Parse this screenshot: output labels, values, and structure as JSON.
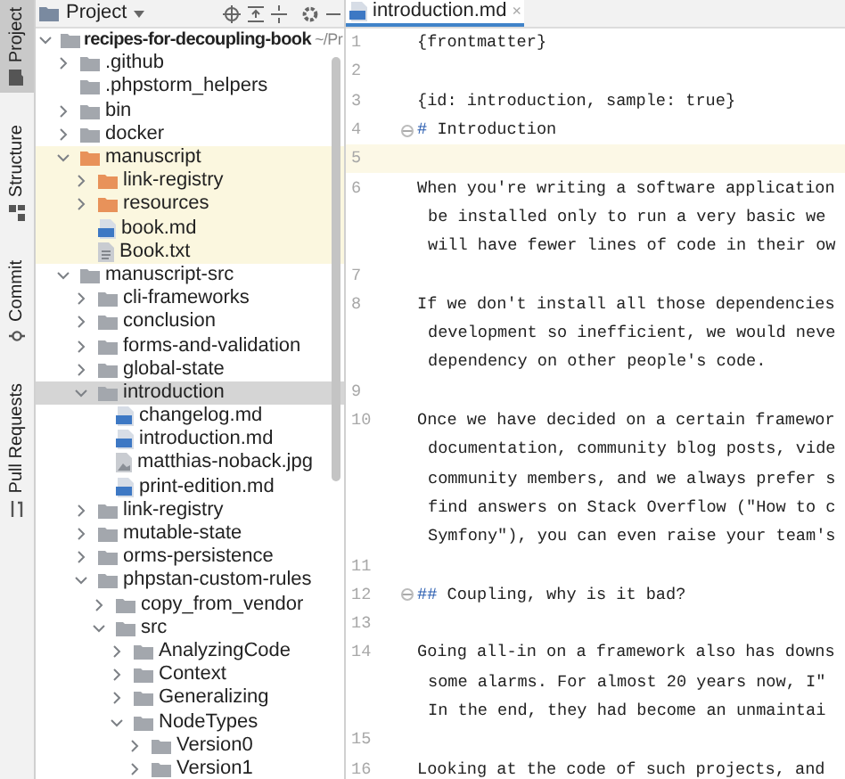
{
  "tool_strip": [
    {
      "label": "Project",
      "selected": true
    },
    {
      "label": "Structure",
      "selected": false
    },
    {
      "label": "Commit",
      "selected": false
    },
    {
      "label": "Pull Requests",
      "selected": false
    }
  ],
  "project_panel": {
    "title": "Project",
    "tree": {
      "name": "recipes-for-decoupling-book",
      "path": "~/Pr",
      "expanded": true,
      "children": [
        {
          "name": ".github",
          "kind": "folder",
          "expanded": false,
          "highlighted": false,
          "selected": false
        },
        {
          "name": ".phpstorm_helpers",
          "kind": "folder",
          "highlighted": false,
          "selected": false
        },
        {
          "name": "bin",
          "kind": "folder",
          "expanded": false,
          "highlighted": false,
          "selected": false
        },
        {
          "name": "docker",
          "kind": "folder",
          "expanded": false,
          "highlighted": false,
          "selected": false
        },
        {
          "name": "manuscript",
          "kind": "resource",
          "expanded": true,
          "highlighted": true,
          "selected": false,
          "children": [
            {
              "name": "link-registry",
              "kind": "resource",
              "expanded": false,
              "selected": false
            },
            {
              "name": "resources",
              "kind": "resource",
              "expanded": false,
              "selected": false
            },
            {
              "name": "book.md",
              "kind": "markdown",
              "selected": false
            },
            {
              "name": "Book.txt",
              "kind": "text",
              "selected": false
            }
          ]
        },
        {
          "name": "manuscript-src",
          "kind": "folder",
          "expanded": true,
          "highlighted": false,
          "selected": false,
          "children": [
            {
              "name": "cli-frameworks",
              "kind": "folder",
              "expanded": false,
              "selected": false
            },
            {
              "name": "conclusion",
              "kind": "folder",
              "expanded": false,
              "selected": false
            },
            {
              "name": "forms-and-validation",
              "kind": "folder",
              "expanded": false,
              "selected": false
            },
            {
              "name": "global-state",
              "kind": "folder",
              "expanded": false,
              "selected": false
            },
            {
              "name": "introduction",
              "kind": "folder",
              "expanded": true,
              "selected": true,
              "children": [
                {
                  "name": "changelog.md",
                  "kind": "markdown",
                  "selected": false
                },
                {
                  "name": "introduction.md",
                  "kind": "markdown",
                  "selected": false
                },
                {
                  "name": "matthias-noback.jpg",
                  "kind": "image",
                  "selected": false
                },
                {
                  "name": "print-edition.md",
                  "kind": "markdown",
                  "selected": false
                }
              ]
            },
            {
              "name": "link-registry",
              "kind": "folder",
              "expanded": false,
              "selected": false
            },
            {
              "name": "mutable-state",
              "kind": "folder",
              "expanded": false,
              "selected": false
            },
            {
              "name": "orms-persistence",
              "kind": "folder",
              "expanded": false,
              "selected": false
            },
            {
              "name": "phpstan-custom-rules",
              "kind": "folder",
              "expanded": true,
              "selected": false,
              "children": [
                {
                  "name": "copy_from_vendor",
                  "kind": "folder",
                  "expanded": false,
                  "selected": false
                },
                {
                  "name": "src",
                  "kind": "folder",
                  "expanded": true,
                  "selected": false,
                  "children": [
                    {
                      "name": "AnalyzingCode",
                      "kind": "folder",
                      "expanded": false,
                      "selected": false
                    },
                    {
                      "name": "Context",
                      "kind": "folder",
                      "expanded": false,
                      "selected": false
                    },
                    {
                      "name": "Generalizing",
                      "kind": "folder",
                      "expanded": false,
                      "selected": false
                    },
                    {
                      "name": "NodeTypes",
                      "kind": "folder",
                      "expanded": true,
                      "selected": false,
                      "children": [
                        {
                          "name": "Version0",
                          "kind": "folder",
                          "expanded": false,
                          "selected": false
                        },
                        {
                          "name": "Version1",
                          "kind": "folder",
                          "expanded": false,
                          "selected": false
                        }
                      ]
                    }
                  ]
                }
              ]
            }
          ]
        }
      ]
    }
  },
  "editor": {
    "tab": {
      "label": "introduction.md",
      "close": "×"
    },
    "lines": [
      {
        "number": "1",
        "kind": "text",
        "current": false,
        "rows": [
          "{frontmatter}"
        ]
      },
      {
        "number": "2",
        "kind": "text",
        "current": false
      },
      {
        "number": "3",
        "kind": "text",
        "current": false,
        "rows": [
          "{id: introduction, sample: true}"
        ]
      },
      {
        "number": "4",
        "kind": "heading",
        "current": false,
        "marker": "#",
        "text": "Introduction"
      },
      {
        "number": "5",
        "kind": "text",
        "current": true
      },
      {
        "number": "6",
        "kind": "text",
        "current": false,
        "rows": [
          "When you're writing a software application",
          "be installed only to run a very basic we",
          "will have fewer lines of code in their ow"
        ]
      },
      {
        "number": "7",
        "kind": "text",
        "current": false
      },
      {
        "number": "8",
        "kind": "text",
        "current": false,
        "rows": [
          "If we don't install all those dependencies",
          "development so inefficient, we would neve",
          "dependency on other people's code."
        ]
      },
      {
        "number": "9",
        "kind": "text",
        "current": false
      },
      {
        "number": "10",
        "kind": "text",
        "current": false,
        "rows": [
          "Once we have decided on a certain framewor",
          "documentation, community blog posts, vide",
          "community members, and we always prefer s",
          "find answers on Stack Overflow (\"How to c",
          "Symfony\"), you can even raise your team's"
        ]
      },
      {
        "number": "11",
        "kind": "text",
        "current": false
      },
      {
        "number": "12",
        "kind": "heading",
        "current": false,
        "marker": "##",
        "text": "Coupling, why is it bad?"
      },
      {
        "number": "13",
        "kind": "text",
        "current": false
      },
      {
        "number": "14",
        "kind": "text",
        "current": false,
        "rows": [
          "Going all-in on a framework also has downs",
          "some alarms. For almost 20 years now, I\"",
          "In the end, they had become an unmaintai"
        ]
      },
      {
        "number": "15",
        "kind": "text",
        "current": false
      },
      {
        "number": "16",
        "kind": "text",
        "current": false,
        "rows": [
          "Looking at the code of such projects, and"
        ]
      }
    ]
  }
}
